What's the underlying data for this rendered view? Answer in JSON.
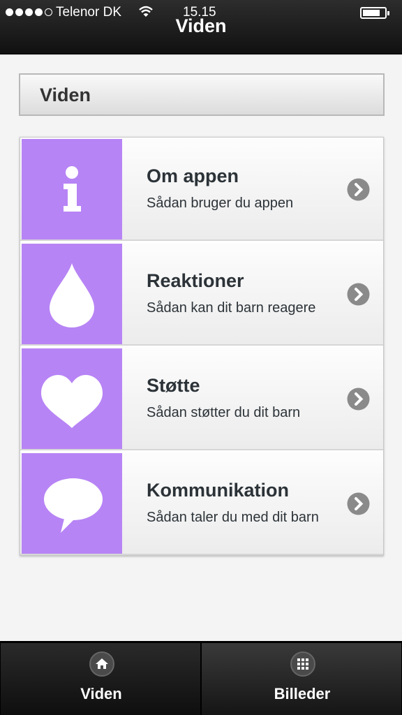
{
  "status": {
    "carrier": "Telenor DK",
    "time": "15.15"
  },
  "nav": {
    "title": "Viden"
  },
  "section": {
    "title": "Viden"
  },
  "items": [
    {
      "title": "Om appen",
      "subtitle": "Sådan bruger du appen",
      "icon": "info-icon"
    },
    {
      "title": "Reaktioner",
      "subtitle": "Sådan kan dit barn reagere",
      "icon": "drop-icon"
    },
    {
      "title": "Støtte",
      "subtitle": "Sådan støtter du dit barn",
      "icon": "heart-icon"
    },
    {
      "title": "Kommunikation",
      "subtitle": "Sådan taler du med dit barn",
      "icon": "speech-bubble-icon"
    }
  ],
  "tabs": [
    {
      "label": "Viden",
      "icon": "home-icon",
      "active": true
    },
    {
      "label": "Billeder",
      "icon": "grid-icon",
      "active": false
    }
  ],
  "colors": {
    "accent": "#b784f5",
    "navbar": "#1a1a1a",
    "text": "#2c3338"
  }
}
